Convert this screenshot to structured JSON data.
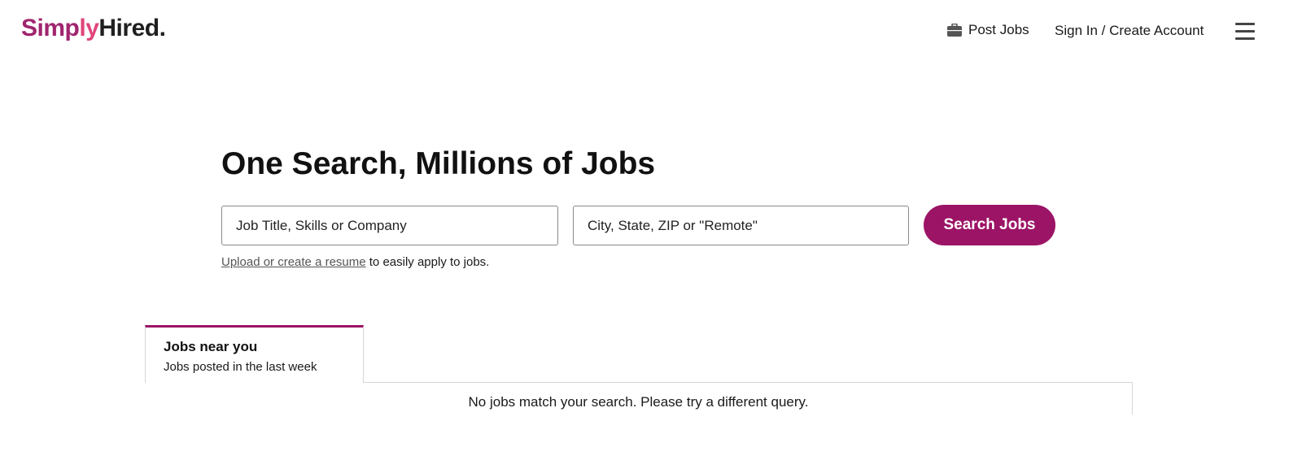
{
  "header": {
    "logo": {
      "part1": "Simply",
      "part2": "Hired",
      "dot": "."
    },
    "post_jobs_label": "Post Jobs",
    "post_jobs_icon": "briefcase-icon",
    "sign_in_label": "Sign In / Create Account",
    "menu_icon": "hamburger-menu-icon"
  },
  "hero": {
    "title": "One Search, Millions of Jobs",
    "what_placeholder": "Job Title, Skills or Company",
    "where_placeholder": "City, State, ZIP or \"Remote\"",
    "search_button_label": "Search Jobs",
    "resume_link_text": "Upload or create a resume",
    "resume_suffix": " to easily apply to jobs."
  },
  "jobs_section": {
    "tabs": [
      {
        "title": "Jobs near you",
        "subtitle": "Jobs posted in the last week",
        "active": true
      }
    ],
    "empty_message": "No jobs match your search. Please try a different query."
  },
  "colors": {
    "brand_primary": "#9c1466",
    "logo_simply": "#a0246e",
    "logo_accent": "#e0457b",
    "text": "#1a1a1a"
  }
}
